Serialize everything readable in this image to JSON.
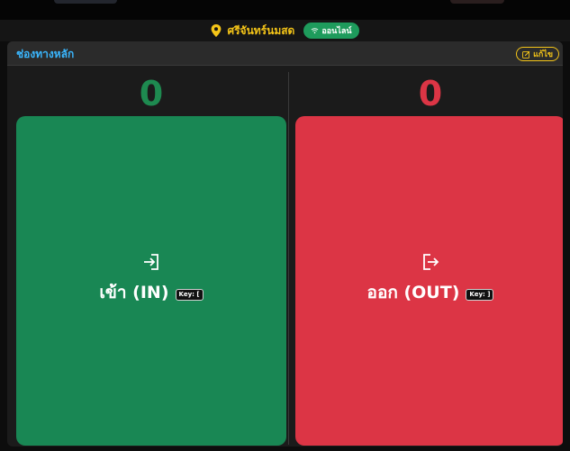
{
  "header": {
    "location_icon": "map-pin-icon",
    "store_name": "ศรีจันทร์นมสด",
    "status_icon": "wifi-icon",
    "status_label": "ออนไลน์"
  },
  "panel": {
    "title": "ช่องทางหลัก",
    "edit_icon": "edit-icon",
    "edit_label": "แก้ไข"
  },
  "entry": {
    "count": "0",
    "icon": "sign-in-icon",
    "label": "เข้า (IN)",
    "key_hint": "Key: ["
  },
  "exit": {
    "count": "0",
    "icon": "sign-out-icon",
    "label": "ออก (OUT)",
    "key_hint": "Key: ]"
  },
  "colors": {
    "in": "#198754",
    "out": "#dc3545",
    "accent_yellow": "#f5c518",
    "accent_blue": "#3ab7ff",
    "online": "#1e9b5c"
  }
}
